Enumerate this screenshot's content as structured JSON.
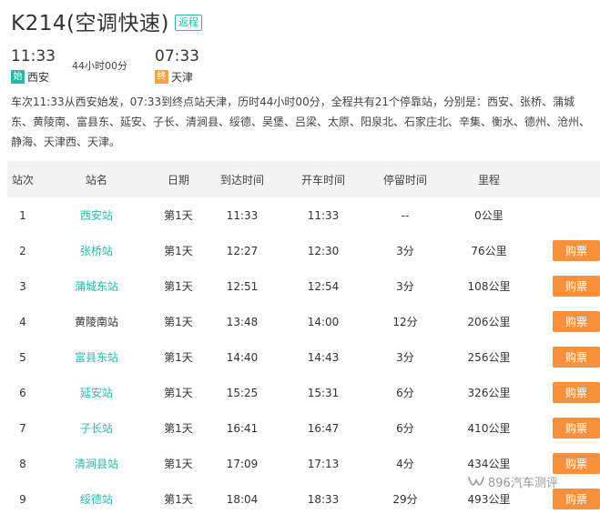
{
  "header": {
    "train_title": "K214(空调快速)",
    "return_label": "返程"
  },
  "timing": {
    "dep_time": "11:33",
    "arr_time": "07:33",
    "duration": "44小时00分",
    "dep_tag": "始",
    "dep_station": "西安",
    "arr_tag": "终",
    "arr_station": "天津"
  },
  "summary": "车次11:33从西安始发，07:33到终点站天津，历时44小时00分，全程共有21个停靠站，分别是：西安、张桥、蒲城东、黄陵南、富县东、延安、子长、清涧县、绥德、吴堡、吕梁、太原、阳泉北、石家庄北、辛集、衡水、德州、沧州、静海、天津西、天津。",
  "table": {
    "headers": [
      "站次",
      "站名",
      "日期",
      "到达时间",
      "开车时间",
      "停留时间",
      "里程"
    ],
    "buy_label": "购票",
    "rows": [
      {
        "idx": "1",
        "name": "西安站",
        "day": "第1天",
        "arr": "11:33",
        "dep": "11:33",
        "stay": "--",
        "dist": "0公里",
        "link": true,
        "buy": false
      },
      {
        "idx": "2",
        "name": "张桥站",
        "day": "第1天",
        "arr": "12:27",
        "dep": "12:30",
        "stay": "3分",
        "dist": "76公里",
        "link": true,
        "buy": true
      },
      {
        "idx": "3",
        "name": "蒲城东站",
        "day": "第1天",
        "arr": "12:51",
        "dep": "12:54",
        "stay": "3分",
        "dist": "108公里",
        "link": true,
        "buy": true
      },
      {
        "idx": "4",
        "name": "黄陵南站",
        "day": "第1天",
        "arr": "13:48",
        "dep": "14:00",
        "stay": "12分",
        "dist": "206公里",
        "link": false,
        "buy": true
      },
      {
        "idx": "5",
        "name": "富县东站",
        "day": "第1天",
        "arr": "14:40",
        "dep": "14:43",
        "stay": "3分",
        "dist": "256公里",
        "link": true,
        "buy": true
      },
      {
        "idx": "6",
        "name": "延安站",
        "day": "第1天",
        "arr": "15:25",
        "dep": "15:31",
        "stay": "6分",
        "dist": "326公里",
        "link": true,
        "buy": true
      },
      {
        "idx": "7",
        "name": "子长站",
        "day": "第1天",
        "arr": "16:41",
        "dep": "16:47",
        "stay": "6分",
        "dist": "410公里",
        "link": true,
        "buy": true
      },
      {
        "idx": "8",
        "name": "清涧县站",
        "day": "第1天",
        "arr": "17:09",
        "dep": "17:13",
        "stay": "4分",
        "dist": "434公里",
        "link": true,
        "buy": true
      },
      {
        "idx": "9",
        "name": "绥德站",
        "day": "第1天",
        "arr": "18:04",
        "dep": "18:33",
        "stay": "29分",
        "dist": "493公里",
        "link": true,
        "buy": true
      }
    ]
  },
  "watermark": {
    "text": "896汽车测评",
    "icon": "wechat-channel-icon"
  },
  "colors": {
    "accent_teal": "#2ab7a9",
    "button_orange": "#f8913d",
    "end_tag_orange": "#f5a24c",
    "header_bg": "#f4f4f4"
  }
}
